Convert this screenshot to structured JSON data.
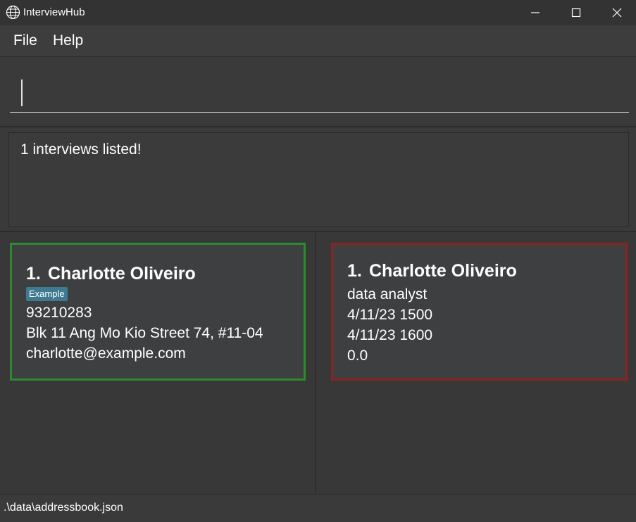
{
  "window": {
    "title": "InterviewHub"
  },
  "menubar": {
    "items": [
      "File",
      "Help"
    ]
  },
  "command_box": {
    "value": ""
  },
  "result_display": {
    "text": "1 interviews listed!"
  },
  "applicants": [
    {
      "index": "1.",
      "name": "Charlotte Oliveiro",
      "tag": "Example",
      "phone": "93210283",
      "address": "Blk 11 Ang Mo Kio Street 74, #11-04",
      "email": "charlotte@example.com"
    }
  ],
  "interviews": [
    {
      "index": "1.",
      "name": "Charlotte Oliveiro",
      "role": "data analyst",
      "start": "4/11/23 1500",
      "end": "4/11/23 1600",
      "rating": "0.0"
    }
  ],
  "statusbar": {
    "path": ".\\data\\addressbook.json"
  },
  "colors": {
    "applicant_border": "#2e8a2e",
    "interview_border": "#8b2323",
    "tag_bg": "#3e7b91"
  }
}
